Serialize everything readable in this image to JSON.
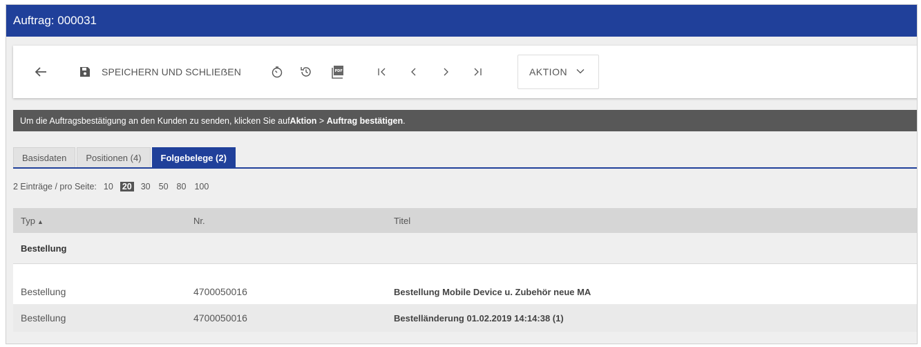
{
  "window": {
    "title": "Auftrag: 000031"
  },
  "toolbar": {
    "save_label": "SPEICHERN UND SCHLIEẞEN",
    "action_label": "AKTION"
  },
  "info": {
    "prefix": "Um die Auftragsbestätigung an den Kunden zu senden, klicken Sie auf ",
    "bold1": "Aktion",
    "sep": " > ",
    "bold2": "Auftrag bestätigen",
    "suffix": "."
  },
  "tabs": [
    {
      "label": "Basisdaten",
      "active": false
    },
    {
      "label": "Positionen (4)",
      "active": false
    },
    {
      "label": "Folgebelege (2)",
      "active": true
    }
  ],
  "pager": {
    "label": "2 Einträge / pro Seite:",
    "options": [
      "10",
      "20",
      "30",
      "50",
      "80",
      "100"
    ],
    "selected": "20"
  },
  "table": {
    "headers": {
      "typ": "Typ",
      "nr": "Nr.",
      "titel": "Titel"
    },
    "group": "Bestellung",
    "rows": [
      {
        "typ": "Bestellung",
        "nr": "4700050016",
        "titel": "Bestellung Mobile Device u. Zubehör neue MA"
      },
      {
        "typ": "Bestellung",
        "nr": "4700050016",
        "titel": "Bestelländerung 01.02.2019 14:14:38 (1)"
      }
    ]
  },
  "colors": {
    "brand": "#20409a",
    "infobar": "#585858"
  },
  "icons": [
    "back-arrow-icon",
    "save-icon",
    "timer-icon",
    "history-icon",
    "pdf-icon",
    "first-page-icon",
    "prev-page-icon",
    "next-page-icon",
    "last-page-icon",
    "chevron-down-icon",
    "sort-up-icon"
  ]
}
